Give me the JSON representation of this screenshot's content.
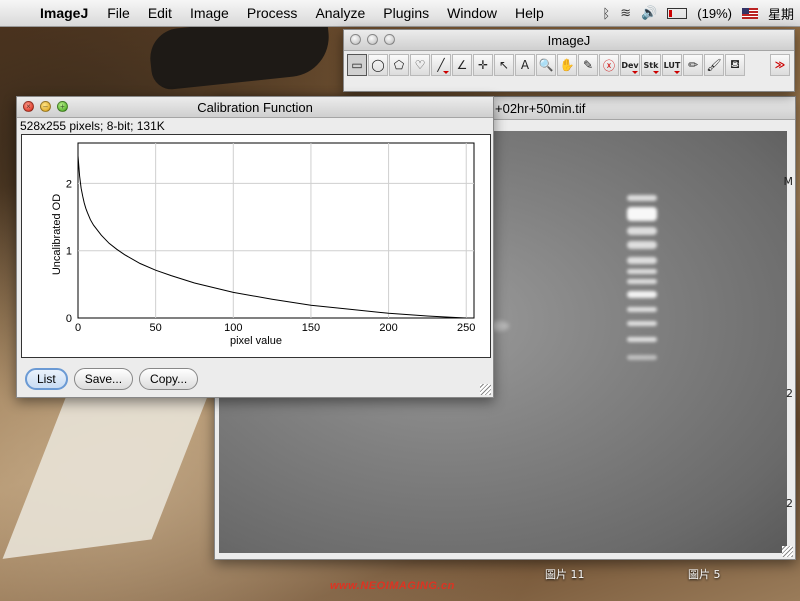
{
  "menubar": {
    "app": "ImageJ",
    "items": [
      "File",
      "Edit",
      "Image",
      "Process",
      "Analyze",
      "Plugins",
      "Window",
      "Help"
    ],
    "battery_text": "(19%)",
    "battery_level": 0.19,
    "clock_text": "星期"
  },
  "toolbar_window": {
    "title": "ImageJ",
    "tools": [
      {
        "icon": "rectangle-select-icon",
        "glyph": "▭"
      },
      {
        "icon": "oval-select-icon",
        "glyph": "◯"
      },
      {
        "icon": "polygon-select-icon",
        "glyph": "⬠"
      },
      {
        "icon": "freehand-select-icon",
        "glyph": "♡"
      },
      {
        "icon": "line-tool-icon",
        "glyph": "╱"
      },
      {
        "icon": "angle-tool-icon",
        "glyph": "∠"
      },
      {
        "icon": "point-tool-icon",
        "glyph": "✛"
      },
      {
        "icon": "wand-tool-icon",
        "glyph": "↖"
      },
      {
        "icon": "text-tool-icon",
        "glyph": "A"
      },
      {
        "icon": "magnifier-icon",
        "glyph": "🔍"
      },
      {
        "icon": "hand-tool-icon",
        "glyph": "✋"
      },
      {
        "icon": "dropper-icon",
        "glyph": "✎"
      },
      {
        "icon": "close-circle-icon",
        "glyph": "ⓧ"
      },
      {
        "icon": "dev-menu-icon",
        "glyph": "Dev"
      },
      {
        "icon": "stk-menu-icon",
        "glyph": "Stk"
      },
      {
        "icon": "lut-menu-icon",
        "glyph": "LUT"
      },
      {
        "icon": "pencil-icon",
        "glyph": "✏"
      },
      {
        "icon": "brush-icon",
        "glyph": "🖌"
      },
      {
        "icon": "flood-fill-icon",
        "glyph": "⛾"
      }
    ],
    "more": "≫"
  },
  "image_window": {
    "title": "+02hr+50min.tif",
    "side_labels": [
      "M",
      "2",
      "2"
    ]
  },
  "calibration_window": {
    "title": "Calibration Function",
    "info": "528x255 pixels; 8-bit; 131K",
    "buttons": {
      "list": "List",
      "save": "Save...",
      "copy": "Copy..."
    }
  },
  "desktop": {
    "labels": [
      "圖片 11",
      "圖片 5"
    ],
    "watermark": "www.NEOIMAGING.cn"
  },
  "chart_data": {
    "type": "line",
    "title": "",
    "xlabel": "pixel value",
    "ylabel": "Uncalibrated OD",
    "xlim": [
      0,
      255
    ],
    "ylim": [
      0,
      2.6
    ],
    "xticks": [
      0,
      50,
      100,
      150,
      200,
      250
    ],
    "yticks": [
      0,
      1,
      2
    ],
    "grid": true,
    "series": [
      {
        "x": [
          0,
          1,
          2,
          3,
          4,
          5,
          6,
          8,
          10,
          15,
          20,
          25,
          30,
          40,
          50,
          60,
          75,
          100,
          125,
          150,
          175,
          200,
          225,
          240,
          250
        ],
        "y": [
          2.41,
          2.11,
          1.93,
          1.81,
          1.71,
          1.63,
          1.57,
          1.46,
          1.38,
          1.23,
          1.11,
          1.02,
          0.94,
          0.81,
          0.71,
          0.63,
          0.52,
          0.38,
          0.28,
          0.19,
          0.13,
          0.07,
          0.03,
          0.01,
          0.0
        ]
      }
    ]
  }
}
